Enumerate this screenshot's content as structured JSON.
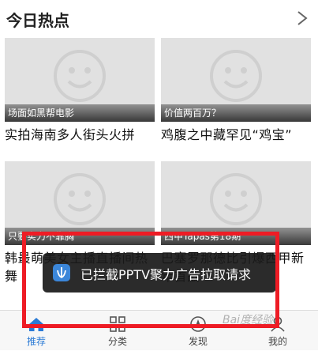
{
  "header": {
    "title": "今日热点"
  },
  "cards": [
    {
      "caption": "场面如黑帮电影",
      "title": "实拍海南多人街头火拼"
    },
    {
      "caption": "价值两百万？",
      "title": "鸡腹之中藏罕见“鸡宝”"
    },
    {
      "caption": "只要实力不靠胸",
      "title": "韩最萌美女主播直播间热舞"
    },
    {
      "caption": "西甲Tapas第18期",
      "title": "巴塞罗那德比引爆西甲新年首战"
    }
  ],
  "toast": {
    "text": "已拦截PPTV聚力广告拉取请求",
    "icon": "shield-icon"
  },
  "nav": [
    {
      "label": "推荐",
      "icon": "home-icon",
      "active": true
    },
    {
      "label": "分类",
      "icon": "grid-icon",
      "active": false
    },
    {
      "label": "发现",
      "icon": "compass-icon",
      "active": false
    },
    {
      "label": "我的",
      "icon": "person-icon",
      "active": false
    }
  ],
  "watermark": "Bai度经验",
  "colors": {
    "accent": "#2a7ad5",
    "highlight": "#ee1c25",
    "toast_bg": "#191919"
  }
}
